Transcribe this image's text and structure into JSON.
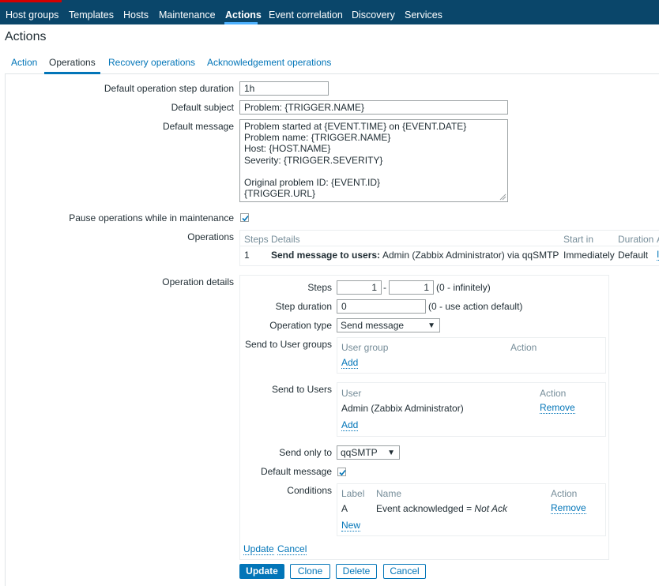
{
  "nav": {
    "items": [
      "Host groups",
      "Templates",
      "Hosts",
      "Maintenance",
      "Actions",
      "Event correlation",
      "Discovery",
      "Services"
    ]
  },
  "page": {
    "title": "Actions"
  },
  "tabs": [
    "Action",
    "Operations",
    "Recovery operations",
    "Acknowledgement operations"
  ],
  "form": {
    "step_duration_label": "Default operation step duration",
    "step_duration_value": "1h",
    "subject_label": "Default subject",
    "subject_value": "Problem: {TRIGGER.NAME}",
    "message_label": "Default message",
    "message_value": "Problem started at {EVENT.TIME} on {EVENT.DATE}\nProblem name: {TRIGGER.NAME}\nHost: {HOST.NAME}\nSeverity: {TRIGGER.SEVERITY}\n\nOriginal problem ID: {EVENT.ID}\n{TRIGGER.URL}",
    "pause_label": "Pause operations while in maintenance",
    "pause_checked": true,
    "operations_label": "Operations"
  },
  "operations_table": {
    "headers": [
      "Steps",
      "Details",
      "Start in",
      "Duration",
      "A"
    ],
    "row": {
      "steps": "1",
      "details_bold": "Send message to users:",
      "details_rest": "Admin (Zabbix Administrator) via qqSMTP",
      "start_in": "Immediately",
      "duration": "Default",
      "action": "I"
    }
  },
  "details": {
    "label": "Operation details",
    "steps_label": "Steps",
    "steps_from": "1",
    "steps_sep": "-",
    "steps_to": "1",
    "steps_hint": "(0 - infinitely)",
    "step_duration_label": "Step duration",
    "step_duration_value": "0",
    "step_duration_hint": "(0 - use action default)",
    "op_type_label": "Operation type",
    "op_type_value": "Send message",
    "user_groups_label": "Send to User groups",
    "user_groups_headers": [
      "User group",
      "Action"
    ],
    "user_groups_add": "Add",
    "users_label": "Send to Users",
    "users_headers": [
      "User",
      "Action"
    ],
    "users_rows": [
      {
        "name": "Admin (Zabbix Administrator)",
        "action": "Remove"
      }
    ],
    "users_add": "Add",
    "send_only_label": "Send only to",
    "send_only_value": "qqSMTP",
    "default_msg_label": "Default message",
    "default_msg_checked": true,
    "conditions_label": "Conditions",
    "conditions_headers": [
      "Label",
      "Name",
      "Action"
    ],
    "conditions_rows": [
      {
        "label": "A",
        "name_prefix": "Event acknowledged = ",
        "name_value": "Not Ack",
        "action": "Remove"
      }
    ],
    "conditions_new": "New",
    "update_link": "Update",
    "cancel_link": "Cancel"
  },
  "buttons": [
    "Update",
    "Clone",
    "Delete",
    "Cancel"
  ],
  "colors": {
    "nav_bg": "#0a466a",
    "accent": "#0275b8",
    "border": "#ebeef0"
  }
}
